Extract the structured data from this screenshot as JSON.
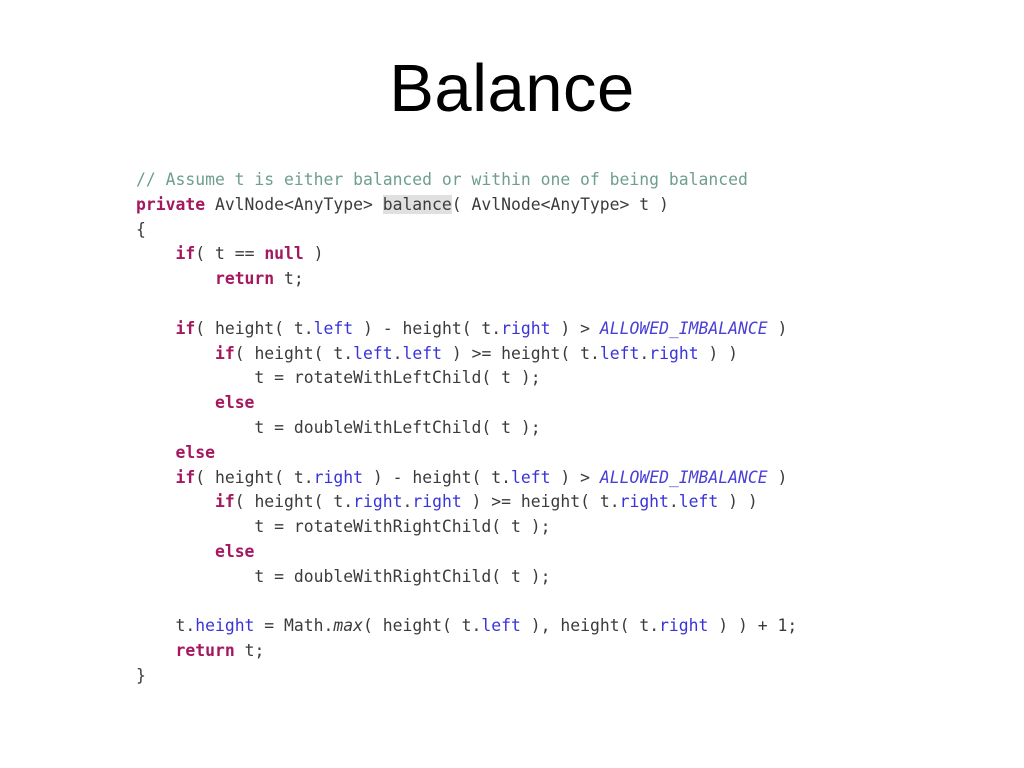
{
  "slide": {
    "title": "Balance",
    "background_color": "#ffffff"
  },
  "colors": {
    "text": "#3b3b3b",
    "comment": "#6e9e8e",
    "keyword": "#a5175e",
    "property": "#3a34d8",
    "constant": "#4a3fd4",
    "highlight_background": "#e0e0e0",
    "title": "#000000"
  },
  "code": {
    "language": "Java",
    "lines": [
      {
        "index": 0,
        "text": "// Assume t is either balanced or within one of being balanced",
        "tokens": [
          {
            "t": "// Assume t is either balanced or within one of being balanced",
            "c": "comment"
          }
        ]
      },
      {
        "index": 1,
        "text": "private AvlNode<AnyType> balance( AvlNode<AnyType> t )",
        "tokens": [
          {
            "t": "private",
            "c": "keyword"
          },
          {
            "t": " AvlNode<AnyType> ",
            "c": "plain"
          },
          {
            "t": "balance",
            "c": "hl"
          },
          {
            "t": "( AvlNode<AnyType> t )",
            "c": "plain"
          }
        ]
      },
      {
        "index": 2,
        "text": "{",
        "tokens": [
          {
            "t": "{",
            "c": "plain"
          }
        ]
      },
      {
        "index": 3,
        "text": "    if( t == null )",
        "tokens": [
          {
            "t": "    ",
            "c": "plain"
          },
          {
            "t": "if",
            "c": "keyword"
          },
          {
            "t": "( t == ",
            "c": "plain"
          },
          {
            "t": "null",
            "c": "keyword"
          },
          {
            "t": " )",
            "c": "plain"
          }
        ]
      },
      {
        "index": 4,
        "text": "        return t;",
        "tokens": [
          {
            "t": "        ",
            "c": "plain"
          },
          {
            "t": "return",
            "c": "keyword"
          },
          {
            "t": " t;",
            "c": "plain"
          }
        ]
      },
      {
        "index": 5,
        "text": "",
        "tokens": []
      },
      {
        "index": 6,
        "text": "    if( height( t.left ) - height( t.right ) > ALLOWED_IMBALANCE )",
        "tokens": [
          {
            "t": "    ",
            "c": "plain"
          },
          {
            "t": "if",
            "c": "keyword"
          },
          {
            "t": "( height( t.",
            "c": "plain"
          },
          {
            "t": "left",
            "c": "prop"
          },
          {
            "t": " ) - height( t.",
            "c": "plain"
          },
          {
            "t": "right",
            "c": "prop"
          },
          {
            "t": " ) > ",
            "c": "plain"
          },
          {
            "t": "ALLOWED_IMBALANCE",
            "c": "const"
          },
          {
            "t": " )",
            "c": "plain"
          }
        ]
      },
      {
        "index": 7,
        "text": "        if( height( t.left.left ) >= height( t.left.right ) )",
        "tokens": [
          {
            "t": "        ",
            "c": "plain"
          },
          {
            "t": "if",
            "c": "keyword"
          },
          {
            "t": "( height( t.",
            "c": "plain"
          },
          {
            "t": "left",
            "c": "prop"
          },
          {
            "t": ".",
            "c": "plain"
          },
          {
            "t": "left",
            "c": "prop"
          },
          {
            "t": " ) >= height( t.",
            "c": "plain"
          },
          {
            "t": "left",
            "c": "prop"
          },
          {
            "t": ".",
            "c": "plain"
          },
          {
            "t": "right",
            "c": "prop"
          },
          {
            "t": " ) )",
            "c": "plain"
          }
        ]
      },
      {
        "index": 8,
        "text": "            t = rotateWithLeftChild( t );",
        "tokens": [
          {
            "t": "            t = rotateWithLeftChild( t );",
            "c": "plain"
          }
        ]
      },
      {
        "index": 9,
        "text": "        else",
        "tokens": [
          {
            "t": "        ",
            "c": "plain"
          },
          {
            "t": "else",
            "c": "keyword"
          }
        ]
      },
      {
        "index": 10,
        "text": "            t = doubleWithLeftChild( t );",
        "tokens": [
          {
            "t": "            t = doubleWithLeftChild( t );",
            "c": "plain"
          }
        ]
      },
      {
        "index": 11,
        "text": "    else",
        "tokens": [
          {
            "t": "    ",
            "c": "plain"
          },
          {
            "t": "else",
            "c": "keyword"
          }
        ]
      },
      {
        "index": 12,
        "text": "    if( height( t.right ) - height( t.left ) > ALLOWED_IMBALANCE )",
        "tokens": [
          {
            "t": "    ",
            "c": "plain"
          },
          {
            "t": "if",
            "c": "keyword"
          },
          {
            "t": "( height( t.",
            "c": "plain"
          },
          {
            "t": "right",
            "c": "prop"
          },
          {
            "t": " ) - height( t.",
            "c": "plain"
          },
          {
            "t": "left",
            "c": "prop"
          },
          {
            "t": " ) > ",
            "c": "plain"
          },
          {
            "t": "ALLOWED_IMBALANCE",
            "c": "const"
          },
          {
            "t": " )",
            "c": "plain"
          }
        ]
      },
      {
        "index": 13,
        "text": "        if( height( t.right.right ) >= height( t.right.left ) )",
        "tokens": [
          {
            "t": "        ",
            "c": "plain"
          },
          {
            "t": "if",
            "c": "keyword"
          },
          {
            "t": "( height( t.",
            "c": "plain"
          },
          {
            "t": "right",
            "c": "prop"
          },
          {
            "t": ".",
            "c": "plain"
          },
          {
            "t": "right",
            "c": "prop"
          },
          {
            "t": " ) >= height( t.",
            "c": "plain"
          },
          {
            "t": "right",
            "c": "prop"
          },
          {
            "t": ".",
            "c": "plain"
          },
          {
            "t": "left",
            "c": "prop"
          },
          {
            "t": " ) )",
            "c": "plain"
          }
        ]
      },
      {
        "index": 14,
        "text": "            t = rotateWithRightChild( t );",
        "tokens": [
          {
            "t": "            t = rotateWithRightChild( t );",
            "c": "plain"
          }
        ]
      },
      {
        "index": 15,
        "text": "        else",
        "tokens": [
          {
            "t": "        ",
            "c": "plain"
          },
          {
            "t": "else",
            "c": "keyword"
          }
        ]
      },
      {
        "index": 16,
        "text": "            t = doubleWithRightChild( t );",
        "tokens": [
          {
            "t": "            t = doubleWithRightChild( t );",
            "c": "plain"
          }
        ]
      },
      {
        "index": 17,
        "text": "",
        "tokens": []
      },
      {
        "index": 18,
        "text": "    t.height = Math.max( height( t.left ), height( t.right ) ) + 1;",
        "tokens": [
          {
            "t": "    t.",
            "c": "plain"
          },
          {
            "t": "height",
            "c": "prop"
          },
          {
            "t": " = Math.",
            "c": "plain"
          },
          {
            "t": "max",
            "c": "ital"
          },
          {
            "t": "( height( t.",
            "c": "plain"
          },
          {
            "t": "left",
            "c": "prop"
          },
          {
            "t": " ), height( t.",
            "c": "plain"
          },
          {
            "t": "right",
            "c": "prop"
          },
          {
            "t": " ) ) + 1;",
            "c": "plain"
          }
        ]
      },
      {
        "index": 19,
        "text": "    return t;",
        "tokens": [
          {
            "t": "    ",
            "c": "plain"
          },
          {
            "t": "return",
            "c": "keyword"
          },
          {
            "t": " t;",
            "c": "plain"
          }
        ]
      },
      {
        "index": 20,
        "text": "}",
        "tokens": [
          {
            "t": "}",
            "c": "plain"
          }
        ]
      }
    ]
  }
}
